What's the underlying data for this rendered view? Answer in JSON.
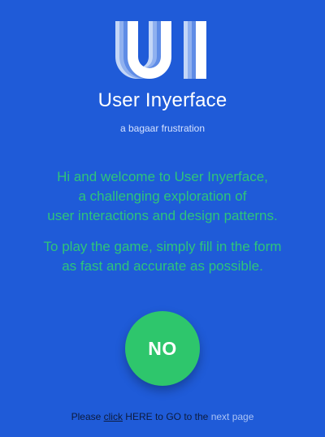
{
  "header": {
    "logo_icon": "ui-logo-icon",
    "logo_text": "UI",
    "title": "User Inyerface",
    "tagline": "a bagaar frustration"
  },
  "welcome": {
    "line1": "Hi and welcome to User Inyerface,",
    "line2": "a challenging exploration of",
    "line3": "user interactions and design patterns.",
    "line4": "To play the game, simply fill in the form",
    "line5": "as fast and accurate as possible."
  },
  "cta": {
    "label": "NO"
  },
  "footer_nav": {
    "prefix": "Please ",
    "click_link": "click",
    "middle": " HERE to GO to the ",
    "next_link": "next page"
  },
  "colors": {
    "background": "#1f5bd8",
    "text_green": "#2fc47a",
    "button_green": "#2ec66c"
  }
}
